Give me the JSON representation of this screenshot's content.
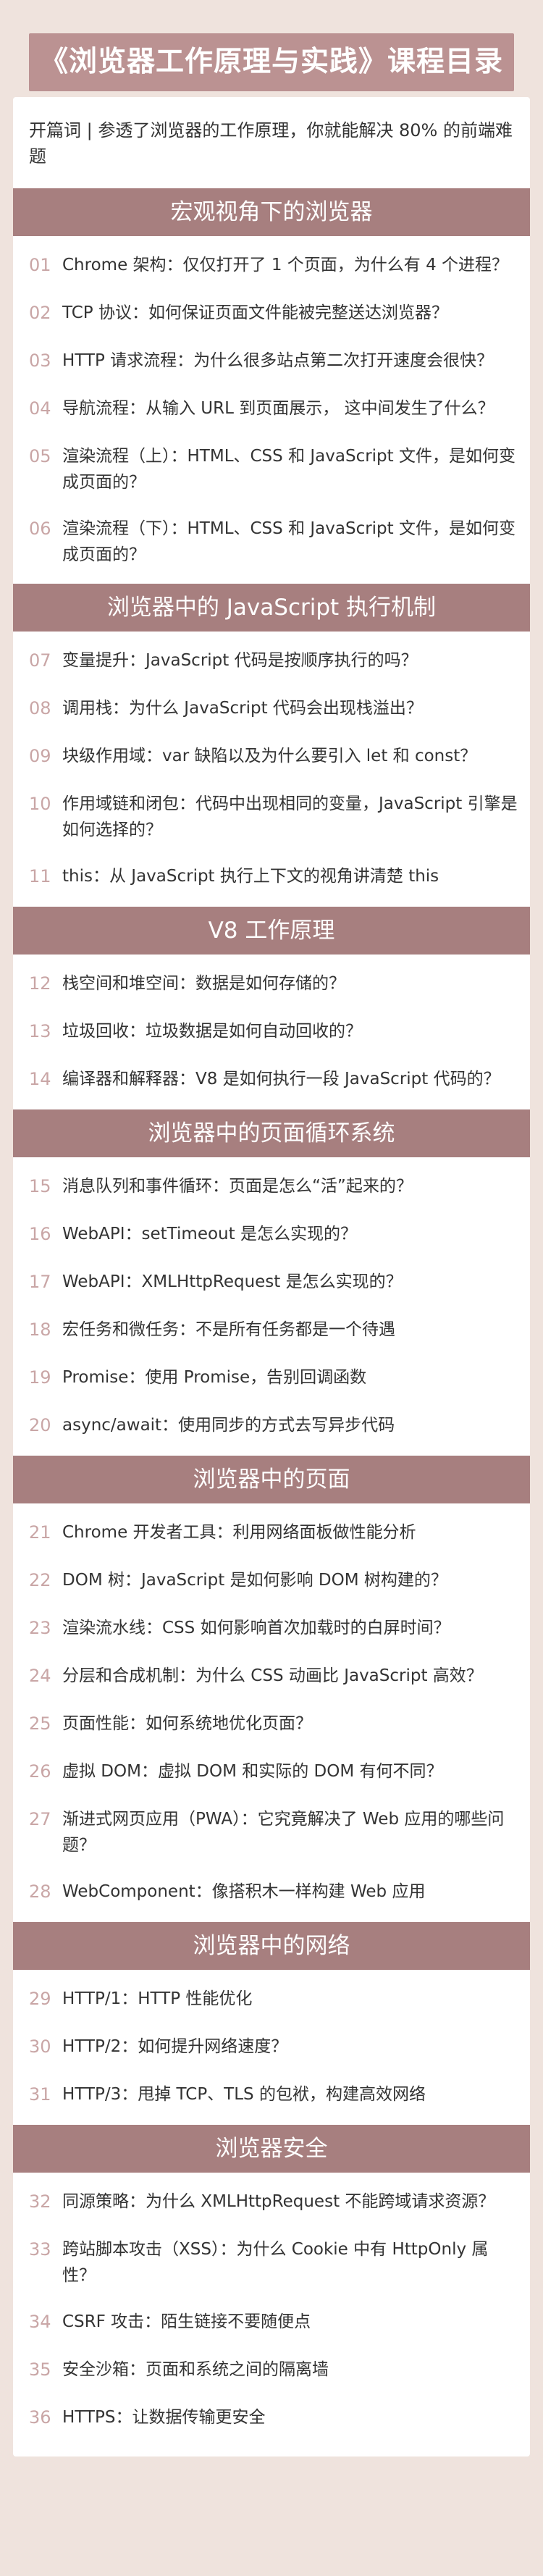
{
  "title": "《浏览器工作原理与实践》课程目录",
  "preface": "开篇词 | 参透了浏览器的工作原理，你就能解决 80% 的前端难题",
  "sections": [
    {
      "title": "宏观视角下的浏览器",
      "items": [
        {
          "num": "01",
          "text": "Chrome 架构：仅仅打开了 1 个页面，为什么有 4 个进程？"
        },
        {
          "num": "02",
          "text": "TCP 协议：如何保证页面文件能被完整送达浏览器？"
        },
        {
          "num": "03",
          "text": "HTTP 请求流程：为什么很多站点第二次打开速度会很快？"
        },
        {
          "num": "04",
          "text": "导航流程：从输入 URL 到页面展示，  这中间发生了什么？"
        },
        {
          "num": "05",
          "text": "渲染流程（上）：HTML、CSS 和 JavaScript 文件，是如何变成页面的？"
        },
        {
          "num": "06",
          "text": "渲染流程（下）：HTML、CSS 和 JavaScript 文件，是如何变成页面的？"
        }
      ]
    },
    {
      "title": "浏览器中的 JavaScript 执行机制",
      "items": [
        {
          "num": "07",
          "text": "变量提升：JavaScript 代码是按顺序执行的吗？"
        },
        {
          "num": "08",
          "text": "调用栈：为什么 JavaScript 代码会出现栈溢出？"
        },
        {
          "num": "09",
          "text": "块级作用域：var 缺陷以及为什么要引入 let 和 const？"
        },
        {
          "num": "10",
          "text": "作用域链和闭包：代码中出现相同的变量，JavaScript 引擎是如何选择的？"
        },
        {
          "num": "11",
          "text": "this：从 JavaScript 执行上下文的视角讲清楚 this"
        }
      ]
    },
    {
      "title": "V8 工作原理",
      "items": [
        {
          "num": "12",
          "text": "栈空间和堆空间：数据是如何存储的？"
        },
        {
          "num": "13",
          "text": "垃圾回收：垃圾数据是如何自动回收的？"
        },
        {
          "num": "14",
          "text": "编译器和解释器：V8 是如何执行一段 JavaScript 代码的？"
        }
      ]
    },
    {
      "title": "浏览器中的页面循环系统",
      "items": [
        {
          "num": "15",
          "text": "消息队列和事件循环：页面是怎么“活”起来的？"
        },
        {
          "num": "16",
          "text": "WebAPI：setTimeout 是怎么实现的？"
        },
        {
          "num": "17",
          "text": "WebAPI：XMLHttpRequest 是怎么实现的？"
        },
        {
          "num": "18",
          "text": "宏任务和微任务：不是所有任务都是一个待遇"
        },
        {
          "num": "19",
          "text": "Promise：使用 Promise，告别回调函数"
        },
        {
          "num": "20",
          "text": "async/await：使用同步的方式去写异步代码"
        }
      ]
    },
    {
      "title": "浏览器中的页面",
      "items": [
        {
          "num": "21",
          "text": "Chrome 开发者工具：利用网络面板做性能分析"
        },
        {
          "num": "22",
          "text": "DOM 树：JavaScript 是如何影响 DOM 树构建的？"
        },
        {
          "num": "23",
          "text": "渲染流水线：CSS 如何影响首次加载时的白屏时间？"
        },
        {
          "num": "24",
          "text": "分层和合成机制：为什么 CSS 动画比 JavaScript 高效？"
        },
        {
          "num": "25",
          "text": "页面性能：如何系统地优化页面？"
        },
        {
          "num": "26",
          "text": "虚拟 DOM：虚拟 DOM 和实际的 DOM 有何不同？"
        },
        {
          "num": "27",
          "text": "渐进式网页应用（PWA）：它究竟解决了 Web 应用的哪些问题？"
        },
        {
          "num": "28",
          "text": "WebComponent：像搭积木一样构建 Web 应用"
        }
      ]
    },
    {
      "title": "浏览器中的网络",
      "items": [
        {
          "num": "29",
          "text": "HTTP/1：HTTP 性能优化"
        },
        {
          "num": "30",
          "text": "HTTP/2：如何提升网络速度？"
        },
        {
          "num": "31",
          "text": "HTTP/3：甩掉 TCP、TLS 的包袱，构建高效网络"
        }
      ]
    },
    {
      "title": "浏览器安全",
      "items": [
        {
          "num": "32",
          "text": "同源策略：为什么 XMLHttpRequest 不能跨域请求资源？"
        },
        {
          "num": "33",
          "text": "跨站脚本攻击（XSS）：为什么 Cookie 中有 HttpOnly 属性？"
        },
        {
          "num": "34",
          "text": "CSRF 攻击：陌生链接不要随便点"
        },
        {
          "num": "35",
          "text": "安全沙箱：页面和系统之间的隔离墙"
        },
        {
          "num": "36",
          "text": "HTTPS：让数据传输更安全"
        }
      ]
    }
  ],
  "colors": {
    "background": "#efe3dd",
    "title_banner": "#bb9292",
    "section_header": "#a77f7f",
    "item_number": "#c9a6a6"
  }
}
